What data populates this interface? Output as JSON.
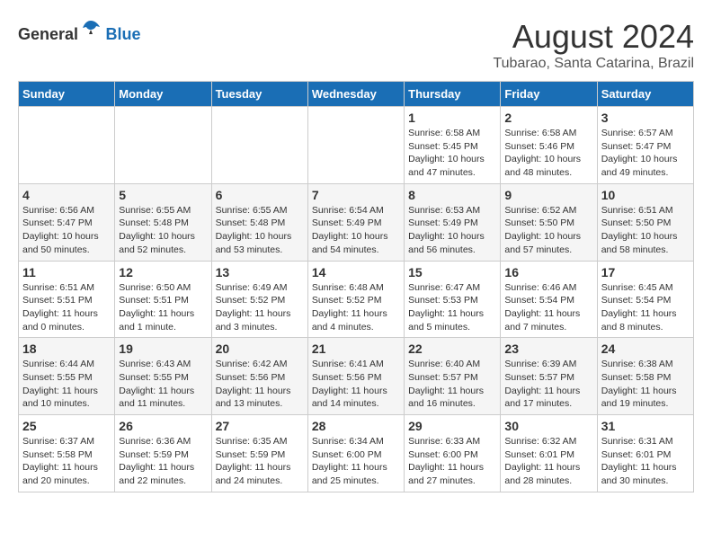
{
  "header": {
    "logo_general": "General",
    "logo_blue": "Blue",
    "month_year": "August 2024",
    "location": "Tubarao, Santa Catarina, Brazil"
  },
  "weekdays": [
    "Sunday",
    "Monday",
    "Tuesday",
    "Wednesday",
    "Thursday",
    "Friday",
    "Saturday"
  ],
  "weeks": [
    [
      {
        "day": "",
        "info": ""
      },
      {
        "day": "",
        "info": ""
      },
      {
        "day": "",
        "info": ""
      },
      {
        "day": "",
        "info": ""
      },
      {
        "day": "1",
        "info": "Sunrise: 6:58 AM\nSunset: 5:45 PM\nDaylight: 10 hours and 47 minutes."
      },
      {
        "day": "2",
        "info": "Sunrise: 6:58 AM\nSunset: 5:46 PM\nDaylight: 10 hours and 48 minutes."
      },
      {
        "day": "3",
        "info": "Sunrise: 6:57 AM\nSunset: 5:47 PM\nDaylight: 10 hours and 49 minutes."
      }
    ],
    [
      {
        "day": "4",
        "info": "Sunrise: 6:56 AM\nSunset: 5:47 PM\nDaylight: 10 hours and 50 minutes."
      },
      {
        "day": "5",
        "info": "Sunrise: 6:55 AM\nSunset: 5:48 PM\nDaylight: 10 hours and 52 minutes."
      },
      {
        "day": "6",
        "info": "Sunrise: 6:55 AM\nSunset: 5:48 PM\nDaylight: 10 hours and 53 minutes."
      },
      {
        "day": "7",
        "info": "Sunrise: 6:54 AM\nSunset: 5:49 PM\nDaylight: 10 hours and 54 minutes."
      },
      {
        "day": "8",
        "info": "Sunrise: 6:53 AM\nSunset: 5:49 PM\nDaylight: 10 hours and 56 minutes."
      },
      {
        "day": "9",
        "info": "Sunrise: 6:52 AM\nSunset: 5:50 PM\nDaylight: 10 hours and 57 minutes."
      },
      {
        "day": "10",
        "info": "Sunrise: 6:51 AM\nSunset: 5:50 PM\nDaylight: 10 hours and 58 minutes."
      }
    ],
    [
      {
        "day": "11",
        "info": "Sunrise: 6:51 AM\nSunset: 5:51 PM\nDaylight: 11 hours and 0 minutes."
      },
      {
        "day": "12",
        "info": "Sunrise: 6:50 AM\nSunset: 5:51 PM\nDaylight: 11 hours and 1 minute."
      },
      {
        "day": "13",
        "info": "Sunrise: 6:49 AM\nSunset: 5:52 PM\nDaylight: 11 hours and 3 minutes."
      },
      {
        "day": "14",
        "info": "Sunrise: 6:48 AM\nSunset: 5:52 PM\nDaylight: 11 hours and 4 minutes."
      },
      {
        "day": "15",
        "info": "Sunrise: 6:47 AM\nSunset: 5:53 PM\nDaylight: 11 hours and 5 minutes."
      },
      {
        "day": "16",
        "info": "Sunrise: 6:46 AM\nSunset: 5:54 PM\nDaylight: 11 hours and 7 minutes."
      },
      {
        "day": "17",
        "info": "Sunrise: 6:45 AM\nSunset: 5:54 PM\nDaylight: 11 hours and 8 minutes."
      }
    ],
    [
      {
        "day": "18",
        "info": "Sunrise: 6:44 AM\nSunset: 5:55 PM\nDaylight: 11 hours and 10 minutes."
      },
      {
        "day": "19",
        "info": "Sunrise: 6:43 AM\nSunset: 5:55 PM\nDaylight: 11 hours and 11 minutes."
      },
      {
        "day": "20",
        "info": "Sunrise: 6:42 AM\nSunset: 5:56 PM\nDaylight: 11 hours and 13 minutes."
      },
      {
        "day": "21",
        "info": "Sunrise: 6:41 AM\nSunset: 5:56 PM\nDaylight: 11 hours and 14 minutes."
      },
      {
        "day": "22",
        "info": "Sunrise: 6:40 AM\nSunset: 5:57 PM\nDaylight: 11 hours and 16 minutes."
      },
      {
        "day": "23",
        "info": "Sunrise: 6:39 AM\nSunset: 5:57 PM\nDaylight: 11 hours and 17 minutes."
      },
      {
        "day": "24",
        "info": "Sunrise: 6:38 AM\nSunset: 5:58 PM\nDaylight: 11 hours and 19 minutes."
      }
    ],
    [
      {
        "day": "25",
        "info": "Sunrise: 6:37 AM\nSunset: 5:58 PM\nDaylight: 11 hours and 20 minutes."
      },
      {
        "day": "26",
        "info": "Sunrise: 6:36 AM\nSunset: 5:59 PM\nDaylight: 11 hours and 22 minutes."
      },
      {
        "day": "27",
        "info": "Sunrise: 6:35 AM\nSunset: 5:59 PM\nDaylight: 11 hours and 24 minutes."
      },
      {
        "day": "28",
        "info": "Sunrise: 6:34 AM\nSunset: 6:00 PM\nDaylight: 11 hours and 25 minutes."
      },
      {
        "day": "29",
        "info": "Sunrise: 6:33 AM\nSunset: 6:00 PM\nDaylight: 11 hours and 27 minutes."
      },
      {
        "day": "30",
        "info": "Sunrise: 6:32 AM\nSunset: 6:01 PM\nDaylight: 11 hours and 28 minutes."
      },
      {
        "day": "31",
        "info": "Sunrise: 6:31 AM\nSunset: 6:01 PM\nDaylight: 11 hours and 30 minutes."
      }
    ]
  ]
}
